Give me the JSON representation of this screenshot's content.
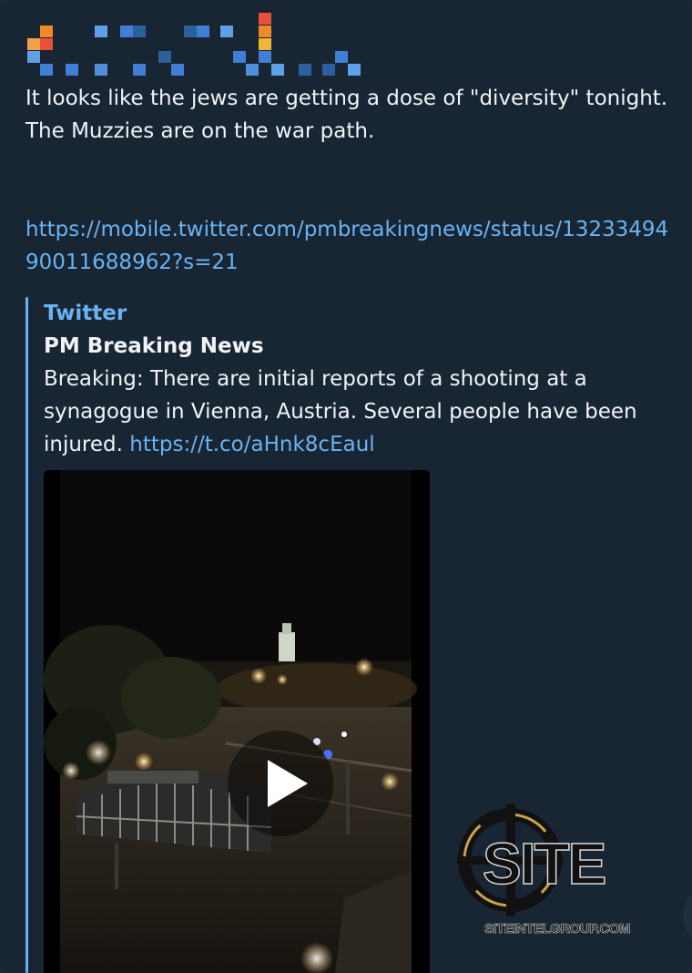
{
  "message": {
    "text": "It looks like the jews are getting a dose of \"diversity\" tonight. The Muzzies are on the war path.",
    "link": "https://mobile.twitter.com/pmbreakingnews/status/1323349490011688962?s=21"
  },
  "preview": {
    "site_name": "Twitter",
    "title": "PM Breaking News",
    "description": "Breaking: There are initial reports of a shooting at a synagogue in Vienna, Austria. Several people have been injured.",
    "description_link": "https://t.co/aHnk8cEaul"
  },
  "video": {
    "play_icon": "play-icon"
  },
  "watermark": {
    "logo": "SITE",
    "url": "SITEINTELGROUP.COM"
  },
  "colors": {
    "bubble": "#182533",
    "link": "#6ab3f3",
    "text": "#f1f4f7"
  }
}
